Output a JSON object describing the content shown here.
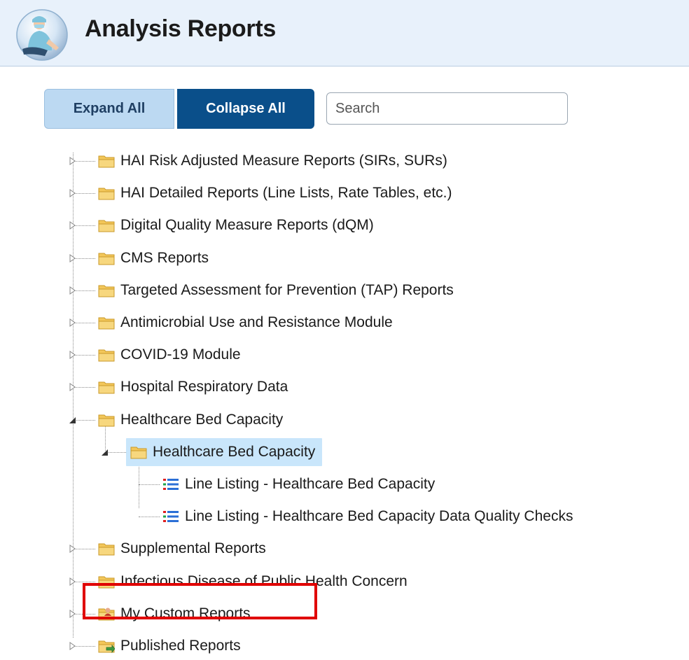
{
  "header": {
    "title": "Analysis Reports",
    "logo_icon": "healthcare-worker-logo-icon",
    "background_color": "#e8f1fb"
  },
  "toolbar": {
    "expand_all_label": "Expand All",
    "collapse_all_label": "Collapse All",
    "search_placeholder": "Search",
    "search_value": "",
    "accent_color": "#0a4f8a"
  },
  "tree": {
    "folder_icon": "folder-icon",
    "report_icon": "report-list-icon",
    "items": [
      {
        "label": "HAI Risk Adjusted Measure Reports (SIRs, SURs)",
        "level": 0,
        "expanded": false
      },
      {
        "label": "HAI Detailed Reports (Line Lists, Rate Tables, etc.)",
        "level": 0,
        "expanded": false
      },
      {
        "label": "Digital Quality Measure Reports (dQM)",
        "level": 0,
        "expanded": false
      },
      {
        "label": "CMS Reports",
        "level": 0,
        "expanded": false
      },
      {
        "label": "Targeted Assessment for Prevention (TAP) Reports",
        "level": 0,
        "expanded": false
      },
      {
        "label": "Antimicrobial Use and Resistance Module",
        "level": 0,
        "expanded": false
      },
      {
        "label": "COVID-19 Module",
        "level": 0,
        "expanded": false
      },
      {
        "label": "Hospital Respiratory Data",
        "level": 0,
        "expanded": false
      },
      {
        "label": "Healthcare Bed Capacity",
        "level": 0,
        "expanded": true
      },
      {
        "label": "Healthcare Bed Capacity",
        "level": 1,
        "expanded": true,
        "selected": true
      },
      {
        "label": "Line Listing - Healthcare Bed Capacity",
        "level": 2
      },
      {
        "label": "Line Listing - Healthcare Bed Capacity Data Quality Checks",
        "level": 2
      },
      {
        "label": "Supplemental Reports",
        "level": 0,
        "expanded": false
      },
      {
        "label": "Infectious Disease of Public Health Concern",
        "level": 0,
        "expanded": false
      },
      {
        "label": "My Custom Reports",
        "level": 0,
        "expanded": false,
        "highlighted": true,
        "icon": "custom-reports-folder-icon"
      },
      {
        "label": "Published Reports",
        "level": 0,
        "expanded": false,
        "icon": "published-reports-folder-icon"
      }
    ]
  },
  "annotation": {
    "highlight_color": "#e00000",
    "highlighted_item": "My Custom Reports"
  }
}
